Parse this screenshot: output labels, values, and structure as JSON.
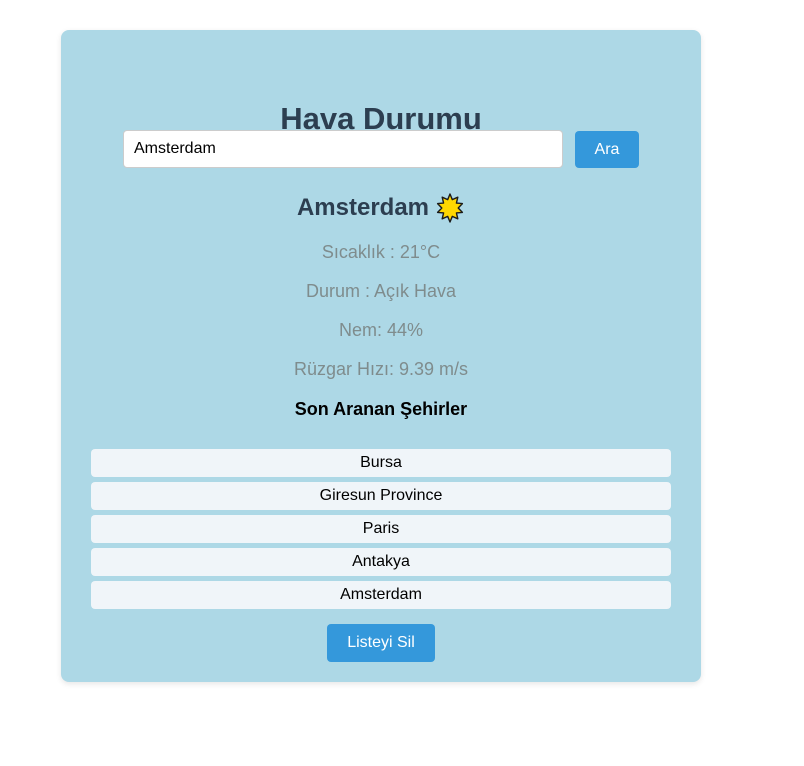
{
  "app": {
    "title": "Hava Durumu"
  },
  "search": {
    "value": "Amsterdam",
    "button_label": "Ara"
  },
  "weather": {
    "city": "Amsterdam",
    "icon": "sun-icon",
    "temperature": "Sıcaklık : 21°C",
    "condition": "Durum : Açık Hava",
    "humidity": "Nem: 44%",
    "wind": "Rüzgar Hızı: 9.39 m/s"
  },
  "recent": {
    "title": "Son Aranan Şehirler",
    "items": [
      {
        "label": "Bursa"
      },
      {
        "label": "Giresun Province"
      },
      {
        "label": "Paris"
      },
      {
        "label": "Antakya"
      },
      {
        "label": "Amsterdam"
      }
    ],
    "clear_label": "Listeyi Sil"
  },
  "colors": {
    "card_background": "#add8e6",
    "accent": "#3498db",
    "title": "#2c3e50",
    "detail_text": "#7f8c8d",
    "list_item_background": "#f0f5f9",
    "sun_fill": "#ffd700"
  }
}
